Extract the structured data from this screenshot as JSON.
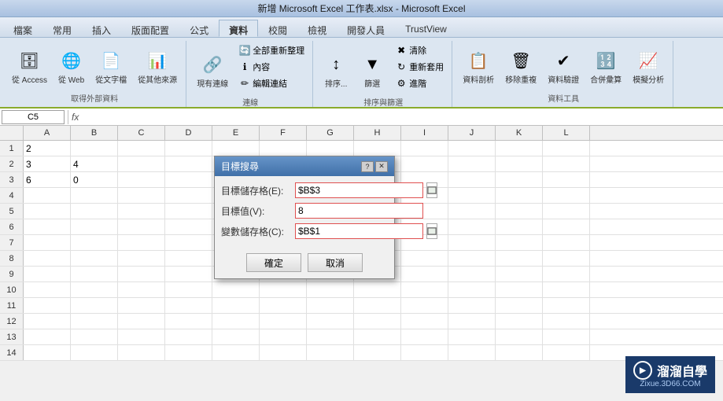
{
  "titlebar": {
    "text": "新增 Microsoft Excel 工作表.xlsx - Microsoft Excel"
  },
  "ribbon": {
    "tabs": [
      "檔案",
      "常用",
      "插入",
      "版面配置",
      "公式",
      "資料",
      "校閱",
      "檢視",
      "開發人員",
      "TrustView"
    ],
    "active_tab": "資料",
    "groups": [
      {
        "label": "取得外部資料",
        "buttons": [
          {
            "label": "從 Access",
            "icon": "🗄"
          },
          {
            "label": "從 Web",
            "icon": "🌐"
          },
          {
            "label": "從文字檔",
            "icon": "📄"
          },
          {
            "label": "從其他來源",
            "icon": "📊"
          }
        ]
      },
      {
        "label": "連線",
        "buttons": [
          {
            "label": "現有連線",
            "icon": "🔗"
          },
          {
            "label": "全部重新整理",
            "icon": "🔄"
          },
          {
            "label": "內容",
            "icon": "ℹ"
          },
          {
            "label": "編輯連結",
            "icon": "✏"
          }
        ]
      },
      {
        "label": "排序與篩選",
        "buttons": [
          {
            "label": "排序...",
            "icon": "↕"
          },
          {
            "label": "篩選",
            "icon": "▼"
          },
          {
            "label": "清除",
            "icon": "✖"
          },
          {
            "label": "重新套用",
            "icon": "↻"
          },
          {
            "label": "進階",
            "icon": "⚙"
          }
        ]
      },
      {
        "label": "資料工具",
        "buttons": [
          {
            "label": "資料剖析",
            "icon": "📋"
          },
          {
            "label": "移除重複",
            "icon": "🗑"
          },
          {
            "label": "資料驗證",
            "icon": "✔"
          },
          {
            "label": "合併彙算",
            "icon": "🔢"
          },
          {
            "label": "模擬分析",
            "icon": "📈"
          }
        ]
      }
    ]
  },
  "formula_bar": {
    "name_box": "C5",
    "fx_label": "fx",
    "formula": ""
  },
  "columns": [
    "A",
    "B",
    "C",
    "D",
    "E",
    "F",
    "G",
    "H",
    "I",
    "J",
    "K",
    "L"
  ],
  "rows": [
    {
      "num": 1,
      "cells": {
        "A": "2",
        "B": "",
        "C": "",
        "D": "",
        "E": "",
        "F": "",
        "G": "",
        "H": "",
        "I": "",
        "J": "",
        "K": "",
        "L": ""
      }
    },
    {
      "num": 2,
      "cells": {
        "A": "3",
        "B": "4",
        "C": "",
        "D": "",
        "E": "",
        "F": "",
        "G": "",
        "H": "",
        "I": "",
        "J": "",
        "K": "",
        "L": ""
      }
    },
    {
      "num": 3,
      "cells": {
        "A": "6",
        "B": "0",
        "C": "",
        "D": "",
        "E": "",
        "F": "",
        "G": "",
        "H": "",
        "I": "",
        "J": "",
        "K": "",
        "L": ""
      }
    },
    {
      "num": 4,
      "cells": {
        "A": "",
        "B": "",
        "C": "",
        "D": "",
        "E": "",
        "F": "",
        "G": "",
        "H": "",
        "I": "",
        "J": "",
        "K": "",
        "L": ""
      }
    },
    {
      "num": 5,
      "cells": {
        "A": "",
        "B": "",
        "C": "",
        "D": "",
        "E": "",
        "F": "",
        "G": "",
        "H": "",
        "I": "",
        "J": "",
        "K": "",
        "L": ""
      }
    },
    {
      "num": 6,
      "cells": {
        "A": "",
        "B": "",
        "C": "",
        "D": "",
        "E": "",
        "F": "",
        "G": "",
        "H": "",
        "I": "",
        "J": "",
        "K": "",
        "L": ""
      }
    },
    {
      "num": 7,
      "cells": {
        "A": "",
        "B": "",
        "C": "",
        "D": "",
        "E": "",
        "F": "",
        "G": "",
        "H": "",
        "I": "",
        "J": "",
        "K": "",
        "L": ""
      }
    },
    {
      "num": 8,
      "cells": {
        "A": "",
        "B": "",
        "C": "",
        "D": "",
        "E": "",
        "F": "",
        "G": "",
        "H": "",
        "I": "",
        "J": "",
        "K": "",
        "L": ""
      }
    },
    {
      "num": 9,
      "cells": {
        "A": "",
        "B": "",
        "C": "",
        "D": "",
        "E": "",
        "F": "",
        "G": "",
        "H": "",
        "I": "",
        "J": "",
        "K": "",
        "L": ""
      }
    },
    {
      "num": 10,
      "cells": {
        "A": "",
        "B": "",
        "C": "",
        "D": "",
        "E": "",
        "F": "",
        "G": "",
        "H": "",
        "I": "",
        "J": "",
        "K": "",
        "L": ""
      }
    },
    {
      "num": 11,
      "cells": {
        "A": "",
        "B": "",
        "C": "",
        "D": "",
        "E": "",
        "F": "",
        "G": "",
        "H": "",
        "I": "",
        "J": "",
        "K": "",
        "L": ""
      }
    },
    {
      "num": 12,
      "cells": {
        "A": "",
        "B": "",
        "C": "",
        "D": "",
        "E": "",
        "F": "",
        "G": "",
        "H": "",
        "I": "",
        "J": "",
        "K": "",
        "L": ""
      }
    },
    {
      "num": 13,
      "cells": {
        "A": "",
        "B": "",
        "C": "",
        "D": "",
        "E": "",
        "F": "",
        "G": "",
        "H": "",
        "I": "",
        "J": "",
        "K": "",
        "L": ""
      }
    },
    {
      "num": 14,
      "cells": {
        "A": "",
        "B": "",
        "C": "",
        "D": "",
        "E": "",
        "F": "",
        "G": "",
        "H": "",
        "I": "",
        "J": "",
        "K": "",
        "L": ""
      }
    }
  ],
  "dialog": {
    "title": "目標搜尋",
    "help_btn": "?",
    "close_btn": "✕",
    "fields": [
      {
        "label": "目標儲存格(E):",
        "value": "$B$3",
        "has_collapse": true,
        "highlight": true
      },
      {
        "label": "目標值(V):",
        "value": "8",
        "has_collapse": false,
        "highlight": true
      },
      {
        "label": "變數儲存格(C):",
        "value": "$B$1",
        "has_collapse": true,
        "highlight": true
      }
    ],
    "ok_btn": "確定",
    "cancel_btn": "取消"
  },
  "watermark": {
    "top_text": "溜溜自學",
    "url_text": "Zixue.3D66.COM"
  }
}
